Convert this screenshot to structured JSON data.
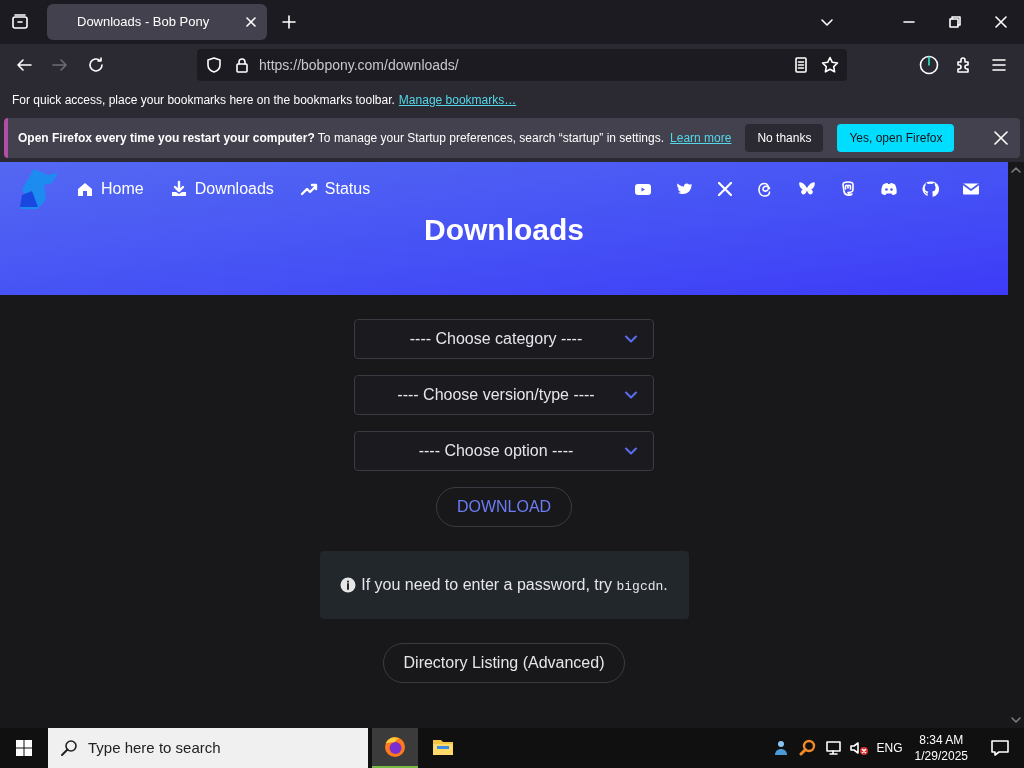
{
  "browser": {
    "tabs": [
      {
        "title": "Downloads - Bob Pony",
        "selected": true
      }
    ],
    "address": {
      "url": "https://bobpony.com/downloads/"
    },
    "bookmarks_bar": {
      "text": "For quick access, place your bookmarks here on the bookmarks toolbar.",
      "link": "Manage bookmarks…"
    },
    "notification": {
      "title": "Open Firefox every time you restart your computer?",
      "text": "To manage your Startup preferences, search “startup” in settings.",
      "link": "Learn more",
      "buttons": [
        {
          "label": "No thanks",
          "kind": "secondary"
        },
        {
          "label": "Yes, open Firefox",
          "kind": "primary"
        }
      ]
    }
  },
  "site": {
    "nav": [
      {
        "label": "Home",
        "kind": "home"
      },
      {
        "label": "Downloads",
        "kind": "download"
      },
      {
        "label": "Status",
        "kind": "trend"
      }
    ],
    "social": [
      {
        "kind": "youtube"
      },
      {
        "kind": "twitter"
      },
      {
        "kind": "x"
      },
      {
        "kind": "threads"
      },
      {
        "kind": "butterfly"
      },
      {
        "kind": "mastodon"
      },
      {
        "kind": "discord"
      },
      {
        "kind": "github"
      },
      {
        "kind": "mail"
      }
    ],
    "heading": "Downloads",
    "selects": [
      {
        "placeholder": "---- Choose category ----"
      },
      {
        "placeholder": "---- Choose version/type ----"
      },
      {
        "placeholder": "---- Choose option ----"
      }
    ],
    "download_button": "DOWNLOAD",
    "info": {
      "text": "If you need to enter a password, try ",
      "code": "bigcdn",
      "after": "."
    },
    "directory_button": "Directory Listing (Advanced)"
  },
  "taskbar": {
    "search": {
      "placeholder": "Type here to search"
    },
    "apps": [
      {
        "kind": "firefox",
        "active": true
      },
      {
        "kind": "explorer",
        "active": false
      }
    ],
    "language": "ENG",
    "time": "8:34 AM",
    "date": "1/29/2025"
  }
}
